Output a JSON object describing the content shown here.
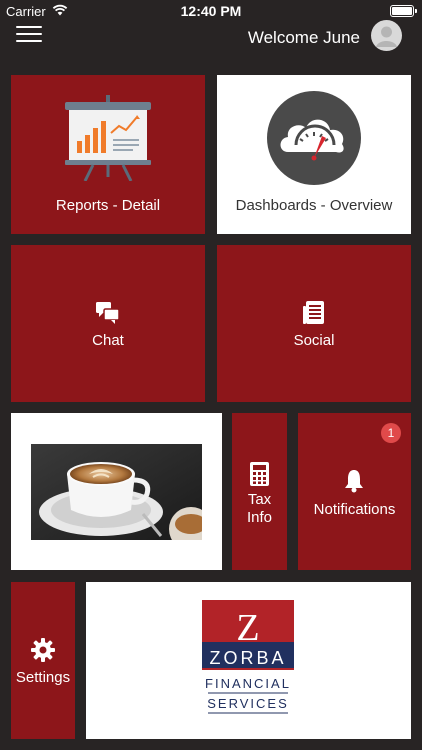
{
  "status_bar": {
    "carrier": "Carrier",
    "time": "12:40 PM"
  },
  "header": {
    "welcome": "Welcome June",
    "menu_icon": "hamburger-icon",
    "avatar_icon": "user-avatar-icon"
  },
  "tiles": {
    "reports": {
      "label": "Reports - Detail",
      "icon": "presentation-chart-icon"
    },
    "dashboards": {
      "label": "Dashboards - Overview",
      "icon": "cloud-gauge-icon"
    },
    "chat": {
      "label": "Chat",
      "icon": "chat-bubbles-icon"
    },
    "social": {
      "label": "Social",
      "icon": "document-icon"
    },
    "coffee": {
      "icon": "coffee-photo"
    },
    "tax": {
      "line1": "Tax",
      "line2": "Info",
      "icon": "calculator-icon"
    },
    "notifications": {
      "label": "Notifications",
      "badge": "1",
      "icon": "bell-icon"
    },
    "settings": {
      "label": "Settings",
      "icon": "gear-icon"
    },
    "logo": {
      "letter": "Z",
      "name": "ZORBA",
      "line1": "FINANCIAL",
      "line2": "SERVICES"
    }
  },
  "colors": {
    "tile_red": "#8d161a",
    "background": "#282424",
    "logo_navy": "#21305f",
    "logo_red": "#b22328",
    "badge": "#e04a4a"
  }
}
